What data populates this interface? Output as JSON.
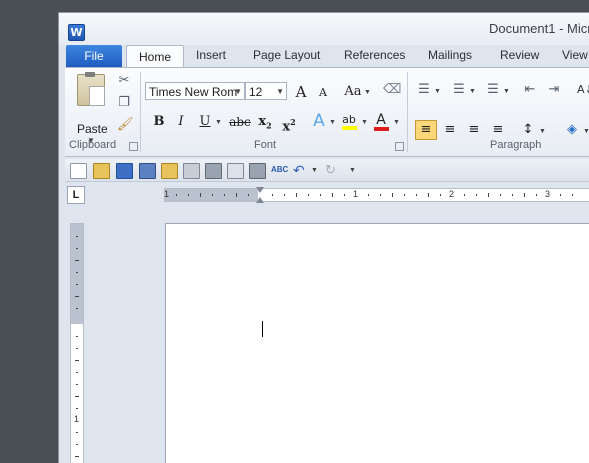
{
  "window": {
    "title": "Document1 - Micr"
  },
  "tabs": [
    "File",
    "Home",
    "Insert",
    "Page Layout",
    "References",
    "Mailings",
    "Review",
    "View"
  ],
  "clipboard": {
    "paste_label": "Paste",
    "group_label": "Clipboard"
  },
  "font": {
    "name": "Times New Rom",
    "size": "12",
    "group_label": "Font",
    "grow": "A",
    "shrink": "A",
    "change_case": "Aa",
    "bold": "B",
    "italic": "I",
    "underline": "U",
    "strike": "abc",
    "sub": "x",
    "sup": "x",
    "sub_mark": "2",
    "sup_mark": "2",
    "effects": "A",
    "highlight": "ab",
    "color": "A"
  },
  "paragraph": {
    "group_label": "Paragraph"
  },
  "ruler": {
    "h_numbers": [
      "1",
      "1",
      "2",
      "3"
    ],
    "v_numbers": [
      "1"
    ]
  },
  "colors": {
    "file_tab": "#2b6fd1",
    "highlight": "#ffff00",
    "font_color": "#e01b1b",
    "align_active": "#fbd77a"
  }
}
